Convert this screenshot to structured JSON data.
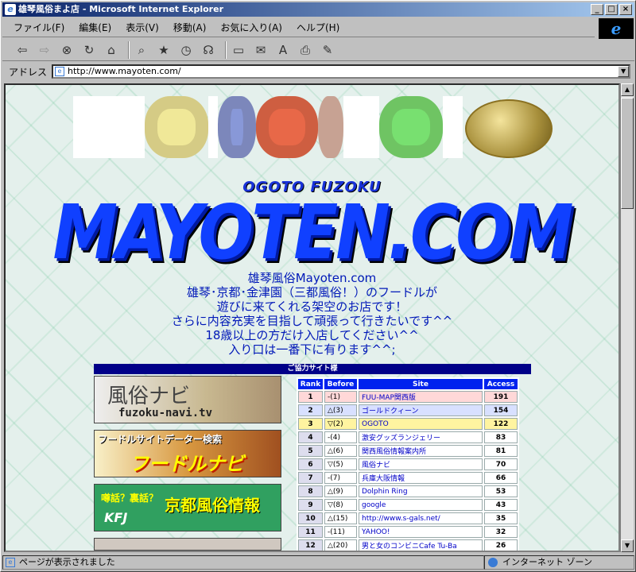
{
  "window": {
    "title": "雄琴風俗まよ店 - Microsoft Internet Explorer",
    "controls": [
      "_",
      "□",
      "×"
    ]
  },
  "menu": [
    "ファイル(F)",
    "編集(E)",
    "表示(V)",
    "移動(A)",
    "お気に入り(A)",
    "ヘルプ(H)"
  ],
  "address": {
    "label": "アドレス",
    "url": "http://www.mayoten.com/"
  },
  "page": {
    "subtitle": "OGOTO FUZOKU",
    "title": "MAYOTEN.COM",
    "intro": [
      "雄琴風俗Mayoten.com",
      "雄琴･京都･金津園（三都風俗！）のフードルが",
      "遊びに来てくれる架空のお店です！",
      "さらに内容充実を目指して頑張って行きたいです^^",
      "18歳以上の方だけ入店してください^^",
      "入り口は一番下に有ります^^;"
    ],
    "section_header": "ご協力サイト様"
  },
  "ads": [
    {
      "line1": "風俗ナビ",
      "line2": "fuzoku-navi.tv"
    },
    {
      "line1": "フードルサイトデーター検索",
      "line2": "フードルナビ"
    },
    {
      "line1": "噂話？裏話？",
      "line2": "京都風俗情報",
      "line3": "KFJ"
    }
  ],
  "ranking": {
    "headers": [
      "Rank",
      "Before",
      "Site",
      "Access"
    ],
    "rows": [
      {
        "rank": "1",
        "before": "-(1)",
        "site": "FUU-MAP関西版",
        "access": "191",
        "trend": "same"
      },
      {
        "rank": "2",
        "before": "△(3)",
        "site": "ゴールドクィーン",
        "access": "154",
        "trend": "up"
      },
      {
        "rank": "3",
        "before": "▽(2)",
        "site": "OGOTO",
        "access": "122",
        "trend": "down"
      },
      {
        "rank": "4",
        "before": "-(4)",
        "site": "激安グッズランジェリー",
        "access": "83",
        "trend": "same"
      },
      {
        "rank": "5",
        "before": "△(6)",
        "site": "関西風俗情報案内所",
        "access": "81",
        "trend": "up"
      },
      {
        "rank": "6",
        "before": "▽(5)",
        "site": "風俗ナビ",
        "access": "70",
        "trend": "down"
      },
      {
        "rank": "7",
        "before": "-(7)",
        "site": "兵庫大阪情報",
        "access": "66",
        "trend": "same"
      },
      {
        "rank": "8",
        "before": "△(9)",
        "site": "Dolphin Ring",
        "access": "53",
        "trend": "up"
      },
      {
        "rank": "9",
        "before": "▽(8)",
        "site": "google",
        "access": "43",
        "trend": "down"
      },
      {
        "rank": "10",
        "before": "△(15)",
        "site": "http://www.s-gals.net/",
        "access": "35",
        "trend": "up"
      },
      {
        "rank": "11",
        "before": "-(11)",
        "site": "YAHOO!",
        "access": "32",
        "trend": "same"
      },
      {
        "rank": "12",
        "before": "△(20)",
        "site": "男と女のコンビニCafe Tu-Ba",
        "access": "26",
        "trend": "up"
      }
    ]
  },
  "status": {
    "left": "ページが表示されました",
    "right": "インターネット ゾーン"
  },
  "icons": [
    "ie-logo-icon",
    "back-icon",
    "forward-icon",
    "stop-icon",
    "refresh-icon",
    "home-icon",
    "search-icon",
    "favorites-icon",
    "history-icon",
    "mail-icon",
    "print-icon",
    "edit-icon",
    "page-icon",
    "globe-icon"
  ]
}
